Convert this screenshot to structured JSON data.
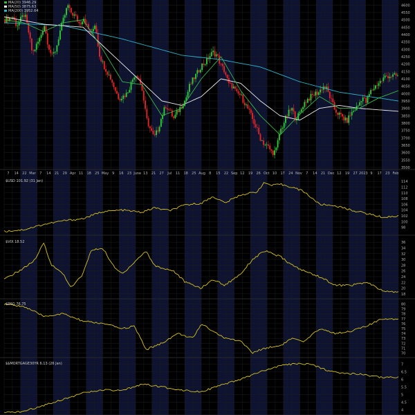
{
  "chart_data": [
    {
      "type": "candlestick",
      "legend": [
        {
          "name": "MA(20) 3946.29",
          "color": "#3cb44b"
        },
        {
          "name": "MA(50) 3875.63",
          "color": "#f0f0f0"
        },
        {
          "name": "MA(200) 3952.64",
          "color": "#2fb5c9"
        }
      ],
      "x_tick_labels": [
        "7",
        "14",
        "22",
        "Mar",
        "7",
        "14",
        "21",
        "29",
        "Apr",
        "11",
        "18",
        "25",
        "May",
        "9",
        "16",
        "23",
        "June",
        "13",
        "21",
        "27",
        "Jul",
        "11",
        "18",
        "25",
        "Aug",
        "8",
        "15",
        "22",
        "Sep",
        "12",
        "19",
        "26",
        "Oct",
        "10",
        "17",
        "24",
        "Nov",
        "7",
        "14",
        "21",
        "Dec",
        "12",
        "19",
        "27",
        "2023",
        "9",
        "17",
        "23",
        "Feb"
      ],
      "y_ticks": [
        3500,
        3550,
        3600,
        3650,
        3700,
        3750,
        3800,
        3850,
        3900,
        3950,
        4000,
        4050,
        4100,
        4150,
        4200,
        4250,
        4300,
        4350,
        4400,
        4450,
        4500,
        4550,
        4600
      ],
      "ylim": [
        3500,
        4620
      ],
      "close_path": [
        [
          0,
          4500
        ],
        [
          0.02,
          4520
        ],
        [
          0.03,
          4460
        ],
        [
          0.05,
          4540
        ],
        [
          0.06,
          4420
        ],
        [
          0.07,
          4270
        ],
        [
          0.09,
          4380
        ],
        [
          0.1,
          4470
        ],
        [
          0.11,
          4330
        ],
        [
          0.12,
          4250
        ],
        [
          0.13,
          4300
        ],
        [
          0.14,
          4420
        ],
        [
          0.15,
          4510
        ],
        [
          0.16,
          4600
        ],
        [
          0.165,
          4560
        ],
        [
          0.18,
          4520
        ],
        [
          0.19,
          4470
        ],
        [
          0.2,
          4520
        ],
        [
          0.21,
          4450
        ],
        [
          0.22,
          4400
        ],
        [
          0.23,
          4480
        ],
        [
          0.24,
          4270
        ],
        [
          0.25,
          4200
        ],
        [
          0.26,
          4150
        ],
        [
          0.27,
          4100
        ],
        [
          0.28,
          4030
        ],
        [
          0.29,
          3970
        ],
        [
          0.3,
          3980
        ],
        [
          0.31,
          4000
        ],
        [
          0.32,
          4060
        ],
        [
          0.33,
          4130
        ],
        [
          0.34,
          4120
        ],
        [
          0.35,
          4020
        ],
        [
          0.36,
          3830
        ],
        [
          0.37,
          3760
        ],
        [
          0.38,
          3700
        ],
        [
          0.39,
          3760
        ],
        [
          0.4,
          3850
        ],
        [
          0.41,
          3920
        ],
        [
          0.42,
          3880
        ],
        [
          0.43,
          3830
        ],
        [
          0.44,
          3880
        ],
        [
          0.45,
          3920
        ],
        [
          0.46,
          3960
        ],
        [
          0.47,
          4050
        ],
        [
          0.48,
          4100
        ],
        [
          0.49,
          4140
        ],
        [
          0.5,
          4190
        ],
        [
          0.51,
          4210
        ],
        [
          0.52,
          4250
        ],
        [
          0.53,
          4280
        ],
        [
          0.54,
          4260
        ],
        [
          0.55,
          4190
        ],
        [
          0.56,
          4150
        ],
        [
          0.57,
          4060
        ],
        [
          0.58,
          4050
        ],
        [
          0.59,
          4000
        ],
        [
          0.6,
          3990
        ],
        [
          0.61,
          3940
        ],
        [
          0.62,
          3890
        ],
        [
          0.63,
          3830
        ],
        [
          0.64,
          3770
        ],
        [
          0.65,
          3700
        ],
        [
          0.66,
          3660
        ],
        [
          0.67,
          3640
        ],
        [
          0.68,
          3600
        ],
        [
          0.69,
          3610
        ],
        [
          0.7,
          3740
        ],
        [
          0.71,
          3800
        ],
        [
          0.72,
          3860
        ],
        [
          0.73,
          3900
        ],
        [
          0.74,
          3830
        ],
        [
          0.75,
          3860
        ],
        [
          0.76,
          3930
        ],
        [
          0.77,
          3960
        ],
        [
          0.78,
          3980
        ],
        [
          0.79,
          4000
        ],
        [
          0.8,
          4010
        ],
        [
          0.81,
          4050
        ],
        [
          0.82,
          4030
        ],
        [
          0.83,
          3960
        ],
        [
          0.84,
          3890
        ],
        [
          0.85,
          3860
        ],
        [
          0.86,
          3840
        ],
        [
          0.87,
          3810
        ],
        [
          0.88,
          3860
        ],
        [
          0.89,
          3890
        ],
        [
          0.9,
          3920
        ],
        [
          0.91,
          3980
        ],
        [
          0.92,
          3940
        ],
        [
          0.93,
          4010
        ],
        [
          0.94,
          4040
        ],
        [
          0.95,
          4070
        ],
        [
          0.96,
          4090
        ],
        [
          0.97,
          4120
        ],
        [
          1,
          4120
        ]
      ],
      "ma20_path": [
        [
          0,
          4500
        ],
        [
          0.05,
          4480
        ],
        [
          0.1,
          4420
        ],
        [
          0.15,
          4480
        ],
        [
          0.2,
          4500
        ],
        [
          0.25,
          4300
        ],
        [
          0.3,
          4080
        ],
        [
          0.35,
          4060
        ],
        [
          0.4,
          3850
        ],
        [
          0.45,
          3900
        ],
        [
          0.5,
          4100
        ],
        [
          0.55,
          4250
        ],
        [
          0.6,
          4020
        ],
        [
          0.65,
          3850
        ],
        [
          0.7,
          3720
        ],
        [
          0.75,
          3860
        ],
        [
          0.8,
          3980
        ],
        [
          0.85,
          3900
        ],
        [
          0.9,
          3900
        ],
        [
          0.95,
          3970
        ],
        [
          1,
          4020
        ]
      ],
      "ma50_path": [
        [
          0,
          4520
        ],
        [
          0.1,
          4470
        ],
        [
          0.2,
          4450
        ],
        [
          0.3,
          4200
        ],
        [
          0.4,
          3950
        ],
        [
          0.45,
          3920
        ],
        [
          0.5,
          3980
        ],
        [
          0.55,
          4100
        ],
        [
          0.6,
          4070
        ],
        [
          0.65,
          3950
        ],
        [
          0.7,
          3850
        ],
        [
          0.75,
          3820
        ],
        [
          0.8,
          3900
        ],
        [
          0.85,
          3920
        ],
        [
          0.9,
          3900
        ],
        [
          0.95,
          3890
        ],
        [
          1,
          3880
        ]
      ],
      "ma200_path": [
        [
          0,
          4480
        ],
        [
          0.15,
          4460
        ],
        [
          0.3,
          4370
        ],
        [
          0.45,
          4260
        ],
        [
          0.55,
          4230
        ],
        [
          0.65,
          4180
        ],
        [
          0.75,
          4080
        ],
        [
          0.85,
          4010
        ],
        [
          0.95,
          3970
        ],
        [
          1,
          3950
        ]
      ]
    },
    {
      "type": "line",
      "series": [
        {
          "name": "$USD 101.92 (31 Jan)"
        }
      ],
      "y_ticks": [
        98,
        100,
        102,
        104,
        106,
        108,
        110,
        112,
        114
      ],
      "ylim": [
        96,
        115
      ],
      "values_path": [
        [
          0,
          96.6
        ],
        [
          0.05,
          97.2
        ],
        [
          0.1,
          99
        ],
        [
          0.15,
          100.3
        ],
        [
          0.2,
          101
        ],
        [
          0.25,
          103.5
        ],
        [
          0.3,
          104
        ],
        [
          0.35,
          103.2
        ],
        [
          0.38,
          104.8
        ],
        [
          0.42,
          103.8
        ],
        [
          0.46,
          105.8
        ],
        [
          0.5,
          106.4
        ],
        [
          0.53,
          108.7
        ],
        [
          0.56,
          106.5
        ],
        [
          0.6,
          109.3
        ],
        [
          0.64,
          110.3
        ],
        [
          0.66,
          113.5
        ],
        [
          0.68,
          112.5
        ],
        [
          0.7,
          113
        ],
        [
          0.73,
          112
        ],
        [
          0.76,
          110.5
        ],
        [
          0.8,
          106
        ],
        [
          0.84,
          105.5
        ],
        [
          0.88,
          104
        ],
        [
          0.92,
          102.8
        ],
        [
          0.96,
          101.5
        ],
        [
          1,
          101.9
        ]
      ]
    },
    {
      "type": "line",
      "series": [
        {
          "name": "$VIX 18.52"
        }
      ],
      "y_ticks": [
        18,
        20,
        22,
        24,
        26,
        28,
        30,
        32,
        34,
        36
      ],
      "ylim": [
        17,
        37
      ],
      "values_path": [
        [
          0,
          23
        ],
        [
          0.05,
          27
        ],
        [
          0.08,
          30
        ],
        [
          0.1,
          36
        ],
        [
          0.12,
          28
        ],
        [
          0.15,
          25
        ],
        [
          0.17,
          20
        ],
        [
          0.2,
          25
        ],
        [
          0.22,
          33
        ],
        [
          0.25,
          34
        ],
        [
          0.28,
          27
        ],
        [
          0.3,
          25
        ],
        [
          0.33,
          29
        ],
        [
          0.36,
          33
        ],
        [
          0.38,
          28
        ],
        [
          0.4,
          27
        ],
        [
          0.43,
          26
        ],
        [
          0.46,
          22
        ],
        [
          0.5,
          20
        ],
        [
          0.53,
          23
        ],
        [
          0.56,
          21
        ],
        [
          0.6,
          25
        ],
        [
          0.63,
          30
        ],
        [
          0.66,
          33
        ],
        [
          0.7,
          31
        ],
        [
          0.73,
          28
        ],
        [
          0.76,
          26
        ],
        [
          0.8,
          24
        ],
        [
          0.84,
          21
        ],
        [
          0.88,
          21
        ],
        [
          0.92,
          22
        ],
        [
          0.96,
          19
        ],
        [
          1,
          18.5
        ]
      ]
    },
    {
      "type": "line",
      "series": [
        {
          "name": "$RSG 76.75"
        }
      ],
      "y_ticks": [
        70,
        71,
        72,
        73,
        74,
        75,
        76,
        77,
        78,
        79,
        80
      ],
      "ylim": [
        69.5,
        80.5
      ],
      "values_path": [
        [
          0,
          80
        ],
        [
          0.05,
          79.5
        ],
        [
          0.1,
          77.5
        ],
        [
          0.15,
          78
        ],
        [
          0.2,
          76.5
        ],
        [
          0.25,
          76
        ],
        [
          0.3,
          75
        ],
        [
          0.33,
          75.5
        ],
        [
          0.36,
          70.7
        ],
        [
          0.4,
          72
        ],
        [
          0.44,
          74
        ],
        [
          0.48,
          73
        ],
        [
          0.5,
          76
        ],
        [
          0.53,
          74.5
        ],
        [
          0.56,
          73
        ],
        [
          0.6,
          72.5
        ],
        [
          0.63,
          70
        ],
        [
          0.66,
          71
        ],
        [
          0.7,
          71.5
        ],
        [
          0.73,
          73
        ],
        [
          0.76,
          72.2
        ],
        [
          0.8,
          75
        ],
        [
          0.84,
          74
        ],
        [
          0.88,
          74.5
        ],
        [
          0.92,
          75.5
        ],
        [
          0.96,
          77
        ],
        [
          1,
          77
        ]
      ]
    },
    {
      "type": "line",
      "series": [
        {
          "name": "$$MORTGAGE30YR 6.13 (26 Jan)"
        }
      ],
      "y_ticks": [
        4.0,
        4.5,
        5.0,
        5.5,
        6.0,
        6.5,
        7.0
      ],
      "ylim": [
        3.8,
        7.2
      ],
      "values_path": [
        [
          0,
          3.8
        ],
        [
          0.05,
          3.9
        ],
        [
          0.1,
          4.3
        ],
        [
          0.15,
          4.7
        ],
        [
          0.2,
          5.1
        ],
        [
          0.25,
          5.3
        ],
        [
          0.3,
          5.25
        ],
        [
          0.35,
          5.7
        ],
        [
          0.4,
          5.5
        ],
        [
          0.45,
          5.3
        ],
        [
          0.5,
          5.2
        ],
        [
          0.55,
          5.6
        ],
        [
          0.6,
          6.0
        ],
        [
          0.65,
          6.5
        ],
        [
          0.68,
          6.7
        ],
        [
          0.7,
          6.9
        ],
        [
          0.75,
          7.05
        ],
        [
          0.78,
          6.95
        ],
        [
          0.82,
          6.6
        ],
        [
          0.86,
          6.4
        ],
        [
          0.9,
          6.35
        ],
        [
          0.95,
          6.15
        ],
        [
          1,
          6.13
        ]
      ]
    }
  ]
}
